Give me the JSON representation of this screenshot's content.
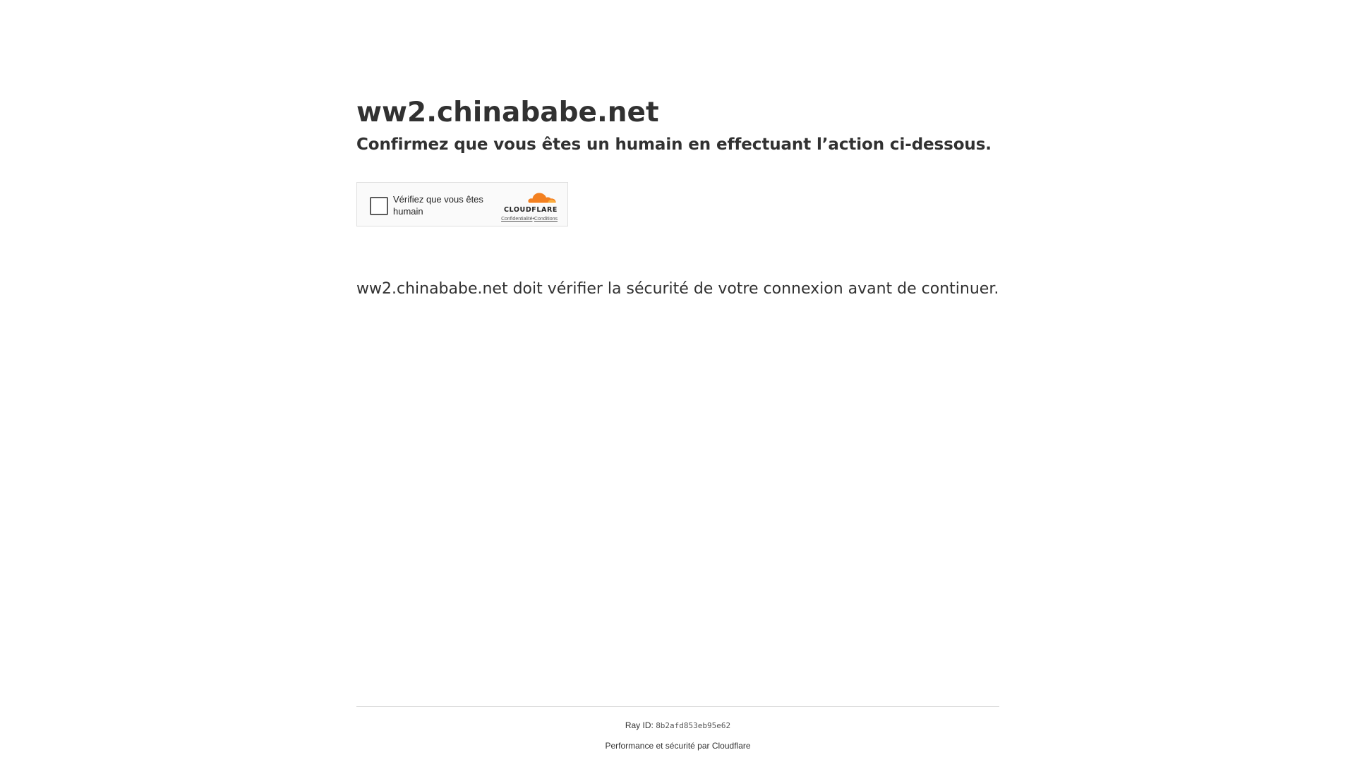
{
  "site": {
    "title": "ww2.chinababe.net",
    "subtitle": "Confirmez que vous êtes un humain en effectuant l’action ci-dessous."
  },
  "widget": {
    "label": "Vérifiez que vous êtes humain",
    "brand": "CLOUDFLARE",
    "privacy_link": "Confidentialité",
    "separator": "•",
    "terms_link": "Conditions",
    "brand_color": "#f38020"
  },
  "main": {
    "security_text": "ww2.chinababe.net doit vérifier la sécurité de votre connexion avant de continuer."
  },
  "footer": {
    "ray_label": "Ray ID:",
    "ray_id": "8b2afd853eb95e62",
    "performance_text": "Performance et sécurité par Cloudflare"
  }
}
